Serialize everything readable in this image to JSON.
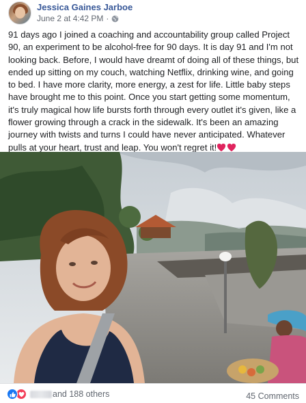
{
  "post": {
    "author": "Jessica Gaines Jarboe",
    "date": "June 2 at 4:42 PM",
    "separator": "·",
    "privacy_icon": "globe-icon",
    "text": "91 days ago I joined a coaching and accountability group called Project 90, an experiment to be alcohol-free for 90 days. It is day 91 and I'm not looking back. Before, I would have dreamt of doing all of these things, but ended up sitting on my couch, watching Netflix, drinking wine, and going to bed. I have more clarity, more energy, a zest for life. Little baby steps have brought me to this point. Once you start getting some momentum, it's truly magical how life bursts forth through every outlet it's given, like a flower growing through a crack in the sidewalk. It's been an amazing journey with twists and turns I could have never anticipated. Whatever pulls at your heart, trust and leap. You won't regret it!",
    "emoji": [
      "red-heart-icon",
      "red-heart-icon"
    ],
    "photo_alt_icon": "selfie-photo"
  },
  "footer": {
    "reaction_icons": [
      "like-icon",
      "love-icon"
    ],
    "others_text": "and 188 others",
    "comments_text": "45 Comments"
  },
  "colors": {
    "author_link": "#385898",
    "meta": "#616770",
    "like_blue": "#1877f2",
    "love_red": "#f33e58"
  }
}
